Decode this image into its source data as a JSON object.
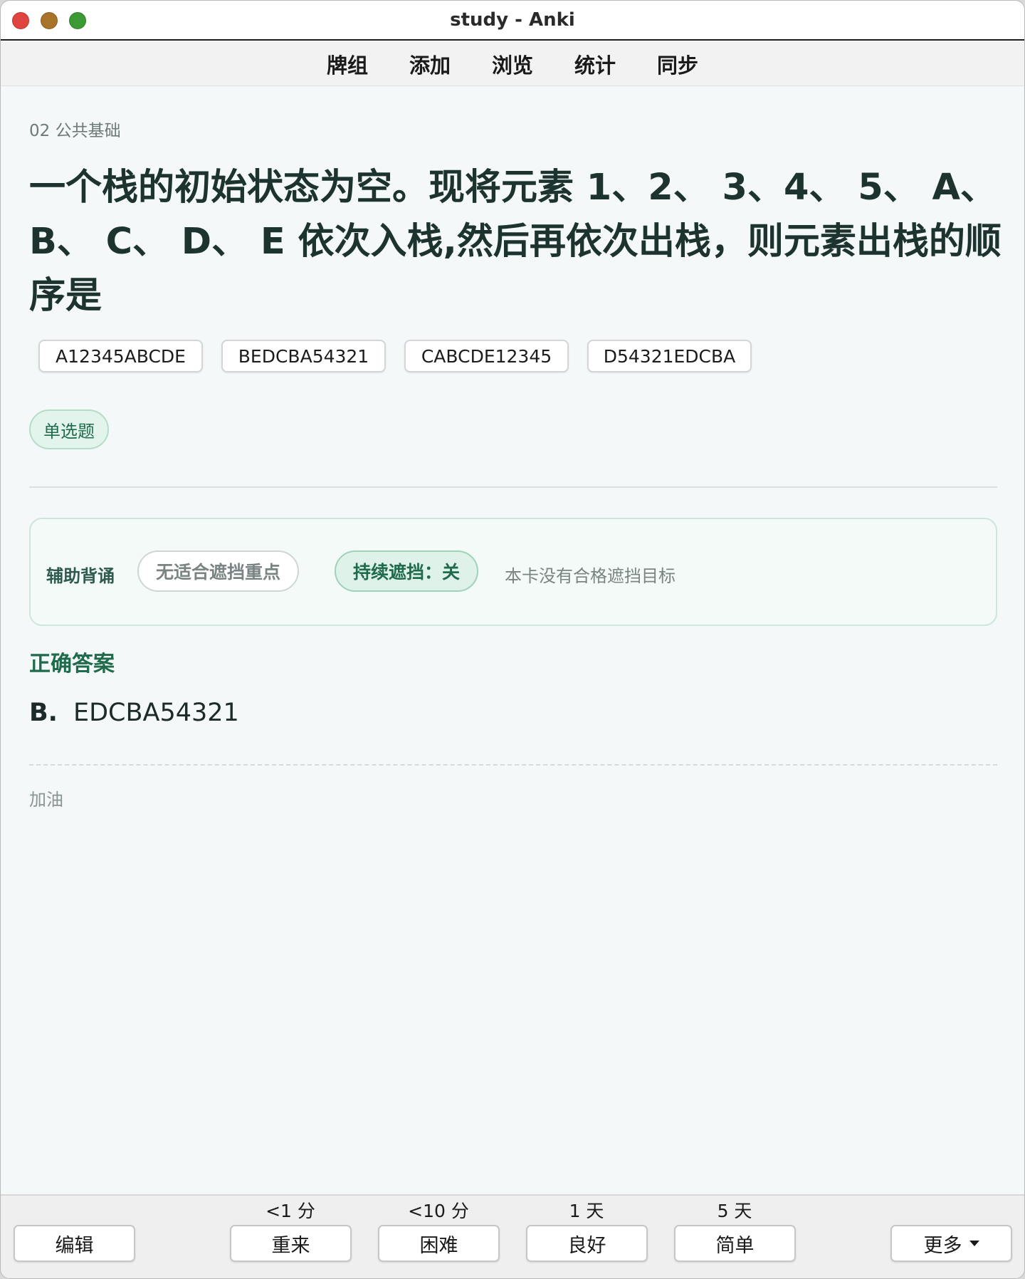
{
  "window": {
    "title": "study - Anki"
  },
  "top_menu": {
    "items": [
      {
        "label": "牌组"
      },
      {
        "label": "添加"
      },
      {
        "label": "浏览"
      },
      {
        "label": "统计"
      },
      {
        "label": "同步"
      }
    ]
  },
  "card": {
    "deck": "02 公共基础",
    "question_line1": "一个栈的初始状态为空。现将元素 1、2、 3、4、 5、 A、",
    "question_line2": "B、 C、 D、 E 依次入栈,然后再依次出栈，则元素出栈的顺",
    "question_line3": "序是",
    "options": [
      {
        "text": "A12345ABCDE"
      },
      {
        "text": "BEDCBA54321"
      },
      {
        "text": "CABCDE12345"
      },
      {
        "text": "D54321EDCBA"
      }
    ],
    "type_badge": "单选题",
    "assist": {
      "label": "辅助背诵",
      "mask_button": "无适合遮挡重点",
      "persist_button": "持续遮挡：关",
      "note": "本卡没有合格遮挡目标"
    },
    "answer_heading": "正确答案",
    "answer_letter": "B.",
    "answer_text": "EDCBA54321",
    "extra": "加油"
  },
  "bottom_bar": {
    "edit_label": "编辑",
    "more_label": "更多",
    "answers": [
      {
        "interval": "<1 分",
        "label": "重来"
      },
      {
        "interval": "<10 分",
        "label": "困难"
      },
      {
        "interval": "1 天",
        "label": "良好"
      },
      {
        "interval": "5 天",
        "label": "简单"
      }
    ]
  },
  "colors": {
    "accent_green": "#1f6b4b",
    "badge_bg": "#e3f4ec",
    "question_text": "#1c3330"
  }
}
